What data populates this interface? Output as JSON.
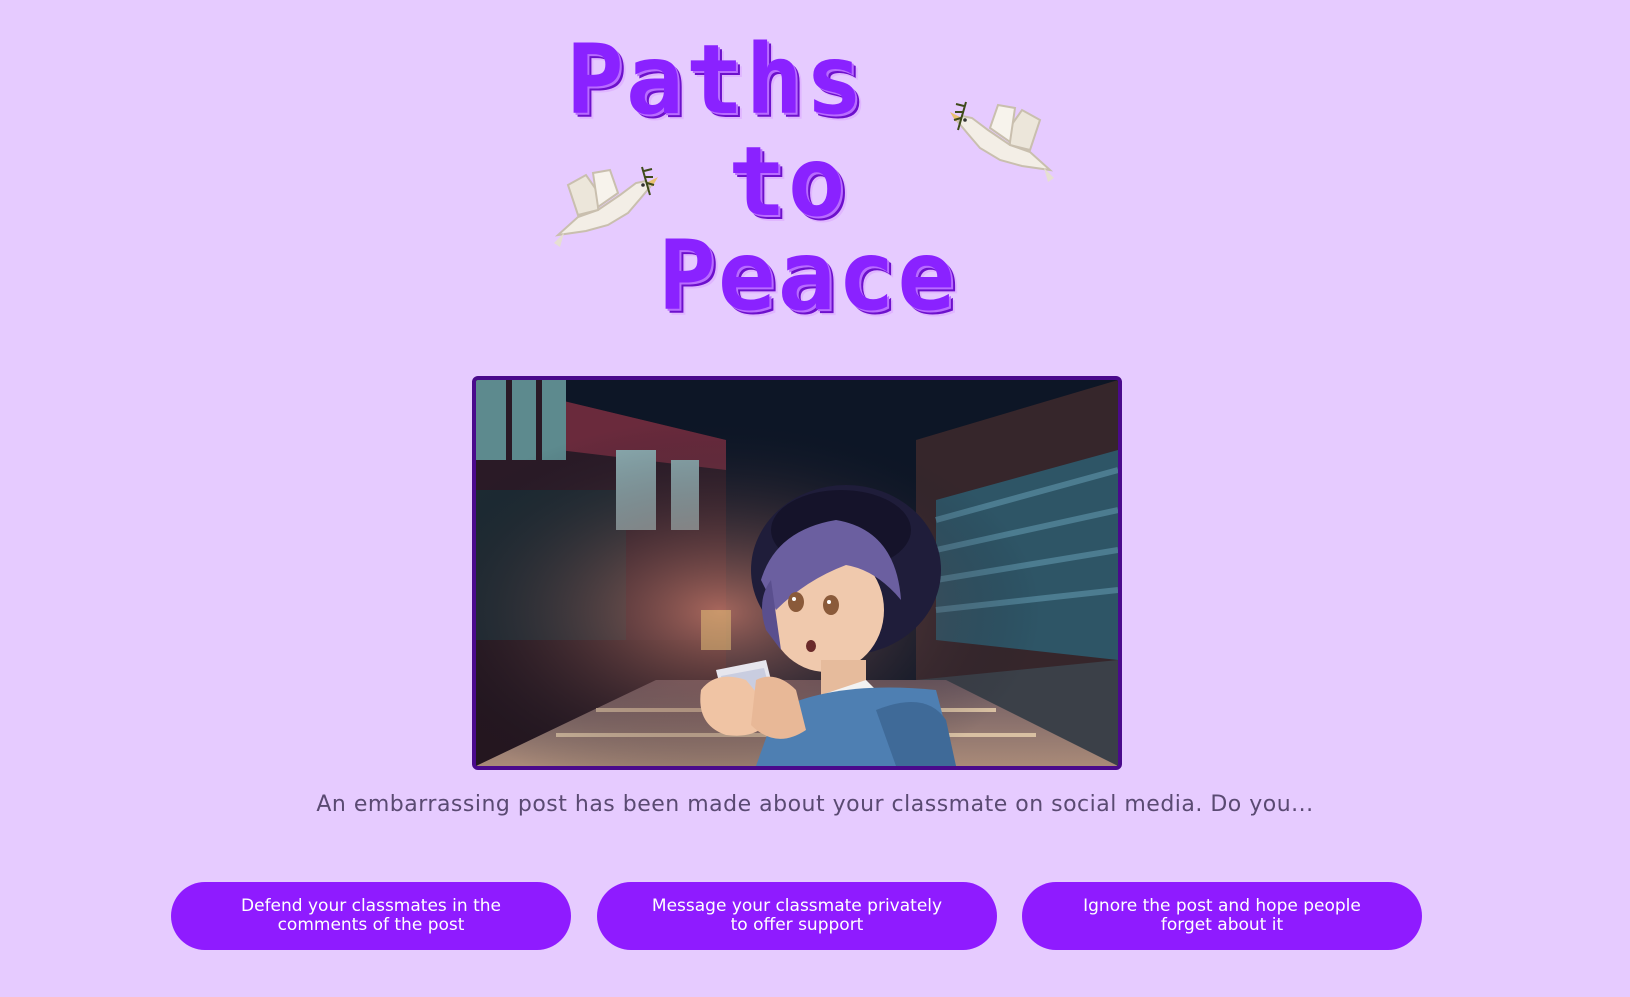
{
  "title": {
    "line1": "Paths",
    "line2": "to",
    "line3": "Peace"
  },
  "icons": {
    "left_decoration": "dove-with-olive-branch-icon",
    "right_decoration": "dove-with-olive-branch-icon"
  },
  "scene": {
    "description_icon": "student-reading-phone-in-hallway-illustration"
  },
  "prompt": {
    "text": "An embarrassing post has been made about your classmate on social media. Do you..."
  },
  "choices": [
    {
      "label": "Defend your classmates in the comments of the post"
    },
    {
      "label": "Message your classmate privately to offer support"
    },
    {
      "label": "Ignore the post and hope people forget about it"
    }
  ],
  "colors": {
    "background": "#e6cbff",
    "accent": "#8f1bff",
    "frame": "#4a0a8c",
    "prompt_text": "#5a4a72"
  }
}
